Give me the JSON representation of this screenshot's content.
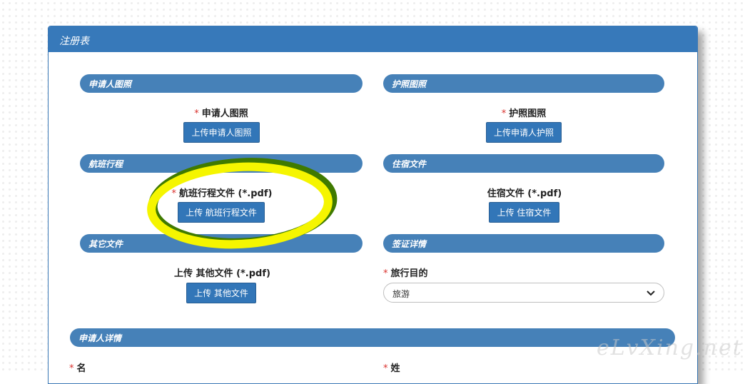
{
  "form": {
    "title": "注册表",
    "sections": {
      "applicant_photo": "申请人图照",
      "passport_photo": "护照图照",
      "flight_itinerary": "航班行程",
      "accommodation": "住宿文件",
      "other_files": "其它文件",
      "visa_details": "签证详情",
      "applicant_details": "申请人详情"
    },
    "fields": {
      "applicant_photo_label": "申请人图照",
      "passport_photo_label": "护照图照",
      "flight_label": "航班行程文件 (*.pdf)",
      "accommodation_label": "住宿文件 (*.pdf)",
      "other_label": "上传 其他文件 (*.pdf)",
      "travel_purpose_label": "旅行目的",
      "first_name_label": "名",
      "last_name_label": "姓"
    },
    "buttons": {
      "upload_applicant_photo": "上传申请人图照",
      "upload_passport": "上传申请人护照",
      "upload_flight": "上传 航班行程文件",
      "upload_accommodation": "上传 住宿文件",
      "upload_other": "上传 其他文件"
    },
    "travel_purpose_select": {
      "selected": "旅游"
    },
    "required_mark": "*"
  },
  "watermark": "eLvXing.net",
  "annotation": {
    "color": "#f5f500",
    "shadow": "#3f7a00"
  },
  "colors": {
    "accent": "#3779ba",
    "pill": "#4681b8",
    "required": "#d9302c"
  }
}
